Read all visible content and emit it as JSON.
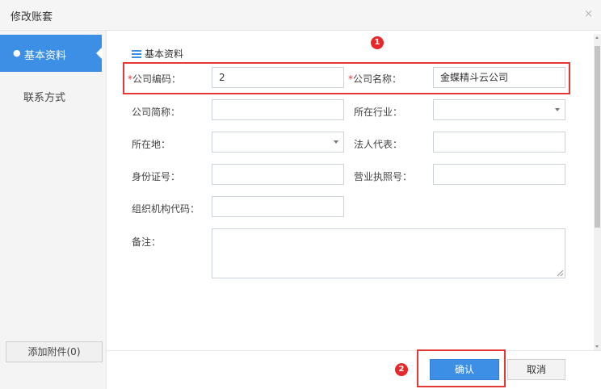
{
  "dialog": {
    "title": "修改账套",
    "close": "×"
  },
  "sidebar": {
    "active_bullet": "●",
    "items": [
      {
        "label": "基本资料",
        "active": true
      },
      {
        "label": "联系方式",
        "active": false
      }
    ],
    "attach_button": "添加附件(0)"
  },
  "section": {
    "title": "基本资料"
  },
  "badges": {
    "one": "1",
    "two": "2"
  },
  "required_mark": "*",
  "form": {
    "company_code": {
      "label": "公司编码：",
      "value": "2",
      "required": true
    },
    "company_name": {
      "label": "公司名称：",
      "value": "金蝶精斗云公司",
      "required": true
    },
    "short_name": {
      "label": "公司简称：",
      "value": ""
    },
    "industry": {
      "label": "所在行业：",
      "value": ""
    },
    "location": {
      "label": "所在地：",
      "value": ""
    },
    "legal_rep": {
      "label": "法人代表：",
      "value": ""
    },
    "id_number": {
      "label": "身份证号：",
      "value": ""
    },
    "license_no": {
      "label": "营业执照号：",
      "value": ""
    },
    "org_code": {
      "label": "组织机构代码：",
      "value": ""
    },
    "remark": {
      "label": "备注：",
      "value": ""
    }
  },
  "buttons": {
    "confirm": "确认",
    "cancel": "取消"
  },
  "colors": {
    "accent": "#3d8fe5",
    "highlight": "#e53935",
    "badge": "#e8272a"
  }
}
